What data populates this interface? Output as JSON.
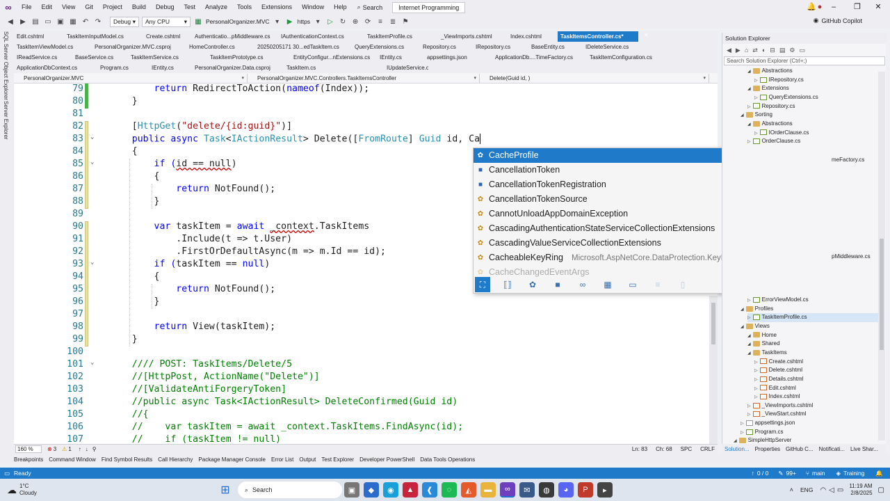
{
  "menu": [
    "File",
    "Edit",
    "View",
    "Git",
    "Project",
    "Build",
    "Debug",
    "Test",
    "Analyze",
    "Tools",
    "Extensions",
    "Window",
    "Help"
  ],
  "search_label": "Search",
  "project_tab": "Internet Programming",
  "toolbar": {
    "config": "Debug",
    "platform": "Any CPU",
    "startup": "PersonalOrganizer.MVC",
    "run_profile": "https",
    "copilot": "GitHub Copilot"
  },
  "left_strip": [
    "SQL Server Object Explorer",
    "Server Explorer"
  ],
  "doc_tabs": [
    [
      "Edit.cshtml",
      "TaskItemInputModel.cs",
      "Create.cshtml",
      "Authenticatio...pMiddleware.cs",
      "IAuthenticationContext.cs",
      "TaskItemProfile.cs",
      "_ViewImports.cshtml",
      "Index.cshtml",
      "TaskItemsController.cs*"
    ],
    [
      "TaskItemViewModel.cs",
      "PersonalOrganizer.MVC.csproj",
      "HomeController.cs",
      "20250205171 30...edTaskItem.cs",
      "QueryExtensions.cs",
      "Repository.cs",
      "IRepository.cs",
      "BaseEntity.cs",
      "IDeleteService.cs"
    ],
    [
      "IReadService.cs",
      "BaseService.cs",
      "TaskItemService.cs",
      "TaskItemPrototype.cs",
      "EntityConfigur...nExtensions.cs",
      "IEntity.cs",
      "appsettings.json",
      "ApplicationDb....TimeFactory.cs",
      "TaskItemConfiguration.cs"
    ],
    [
      "ApplicationDbContext.cs",
      "Program.cs",
      "IEntity.cs",
      "PersonalOrganizer.Data.csproj",
      "TaskItem.cs",
      "IUpdateService.cs"
    ]
  ],
  "nav": {
    "project": "PersonalOrganizer.MVC",
    "class": "PersonalOrganizer.MVC.Controllers.TaskItemsController",
    "member": "Delete(Guid id, )"
  },
  "line_numbers": [
    "79",
    "80",
    "81",
    "82",
    "83",
    "84",
    "85",
    "86",
    "87",
    "88",
    "89",
    "90",
    "91",
    "92",
    "93",
    "94",
    "95",
    "96",
    "97",
    "98",
    "99",
    "100",
    "101",
    "102",
    "103",
    "104",
    "105",
    "106",
    "107"
  ],
  "code": {
    "l79a": "        return ",
    "l79b": "RedirectToAction(",
    "l79c": "nameof",
    "l79d": "(Index));",
    "l80": "    }",
    "l82a": "    [",
    "l82b": "HttpGet",
    "l82c": "(",
    "l82d": "\"delete/{id:guid}\"",
    "l82e": ")]",
    "l83a": "    public async ",
    "l83b": "Task",
    "l83c": "<",
    "l83d": "IActionResult",
    "l83e": "> Delete([",
    "l83f": "FromRoute",
    "l83g": "] ",
    "l83h": "Guid",
    "l83i": " id, Ca",
    "l84": "    {",
    "l85a": "        if (",
    "l85b": "id == null",
    "l85c": ")",
    "l86": "        {",
    "l87a": "            return ",
    "l87b": "NotFound();",
    "l88": "        }",
    "l90a": "        var ",
    "l90b": "taskItem = ",
    "l90c": "await ",
    "l90d": "_context",
    "l90e": ".TaskItems",
    "l91": "            .Include(t => t.User)",
    "l92": "            .FirstOrDefaultAsync(m => m.Id == id);",
    "l93a": "        if (",
    "l93b": "taskItem == ",
    "l93c": "null",
    "l93d": ")",
    "l94": "        {",
    "l95a": "            return ",
    "l95b": "NotFound();",
    "l96": "        }",
    "l98a": "        return ",
    "l98b": "View(taskItem);",
    "l99": "    }",
    "l101": "    //// POST: TaskItems/Delete/5",
    "l102": "    //[HttpPost, ActionName(\"Delete\")]",
    "l103": "    //[ValidateAntiForgeryToken]",
    "l104": "    //public async Task<IActionResult> DeleteConfirmed(Guid id)",
    "l105": "    //{",
    "l106": "    //    var taskItem = await _context.TaskItems.FindAsync(id);",
    "l107": "    //    if (taskItem != null)"
  },
  "intellisense": [
    {
      "label": "CacheProfile",
      "icon": "class-icon",
      "ns": ""
    },
    {
      "label": "CancellationToken",
      "icon": "struct-icon",
      "ns": ""
    },
    {
      "label": "CancellationTokenRegistration",
      "icon": "struct-icon",
      "ns": ""
    },
    {
      "label": "CancellationTokenSource",
      "icon": "class-icon",
      "ns": ""
    },
    {
      "label": "CannotUnloadAppDomainException",
      "icon": "class-icon",
      "ns": ""
    },
    {
      "label": "CascadingAuthenticationStateServiceCollectionExtensions",
      "icon": "class-icon",
      "ns": ""
    },
    {
      "label": "CascadingValueServiceCollectionExtensions",
      "icon": "class-icon",
      "ns": ""
    },
    {
      "label": "CacheableKeyRing",
      "icon": "class-icon",
      "ns": "Microsoft.AspNetCore.DataProtection.KeyManagement.Internal"
    },
    {
      "label": "CacheChangedEventArgs",
      "icon": "class-icon",
      "ns": ""
    }
  ],
  "solution_explorer": {
    "title": "Solution Explorer",
    "search_placeholder": "Search Solution Explorer (Ctrl+;)",
    "nodes": [
      {
        "label": "Abstractions",
        "kind": "folder",
        "indent": 3
      },
      {
        "label": "IRepository.cs",
        "kind": "cs",
        "indent": 4
      },
      {
        "label": "Extensions",
        "kind": "folder",
        "indent": 3
      },
      {
        "label": "QueryExtensions.cs",
        "kind": "cs",
        "indent": 4
      },
      {
        "label": "Repository.cs",
        "kind": "cs",
        "indent": 3
      },
      {
        "label": "Sorting",
        "kind": "folder",
        "indent": 2
      },
      {
        "label": "Abstractions",
        "kind": "folder",
        "indent": 3
      },
      {
        "label": "IOrderClause.cs",
        "kind": "cs",
        "indent": 4
      },
      {
        "label": "OrderClause.cs",
        "kind": "cs",
        "indent": 3
      }
    ],
    "partial_right": [
      "meFactory.cs",
      "pMiddleware.cs"
    ],
    "nodes_lower": [
      {
        "label": "ErrorViewModel.cs",
        "kind": "cs",
        "indent": 3
      },
      {
        "label": "Profiles",
        "kind": "folder",
        "indent": 2
      },
      {
        "label": "TaskItemProfile.cs",
        "kind": "cs",
        "indent": 3,
        "selected": true
      },
      {
        "label": "Views",
        "kind": "folder",
        "indent": 2
      },
      {
        "label": "Home",
        "kind": "folder",
        "indent": 3
      },
      {
        "label": "Shared",
        "kind": "folder",
        "indent": 3
      },
      {
        "label": "TaskItems",
        "kind": "folder",
        "indent": 3
      },
      {
        "label": "Create.cshtml",
        "kind": "html",
        "indent": 4
      },
      {
        "label": "Delete.cshtml",
        "kind": "html",
        "indent": 4
      },
      {
        "label": "Details.cshtml",
        "kind": "html",
        "indent": 4
      },
      {
        "label": "Edit.cshtml",
        "kind": "html",
        "indent": 4
      },
      {
        "label": "Index.cshtml",
        "kind": "html",
        "indent": 4
      },
      {
        "label": "_ViewImports.cshtml",
        "kind": "html",
        "indent": 3
      },
      {
        "label": "_ViewStart.cshtml",
        "kind": "html",
        "indent": 3
      },
      {
        "label": "appsettings.json",
        "kind": "json",
        "indent": 2
      },
      {
        "label": "Program.cs",
        "kind": "cs",
        "indent": 2
      },
      {
        "label": "SimpleHttpServer",
        "kind": "folder",
        "indent": 1
      }
    ],
    "bottom_tabs": [
      "Solution...",
      "Properties",
      "GitHub C...",
      "Notificati...",
      "Live Shar..."
    ]
  },
  "editor_status": {
    "zoom": "160 %",
    "errors": "3",
    "warnings": "1",
    "line": "Ln: 83",
    "col": "Ch: 68",
    "spc": "SPC",
    "crlf": "CRLF"
  },
  "tool_tabs": [
    "Breakpoints",
    "Command Window",
    "Find Symbol Results",
    "Call Hierarchy",
    "Package Manager Console",
    "Error List",
    "Output",
    "Test Explorer",
    "Developer PowerShell",
    "Data Tools Operations"
  ],
  "status": {
    "ready": "Ready",
    "lines": "0 / 0",
    "count": "99+",
    "branch": "main",
    "project": "Training"
  },
  "taskbar": {
    "weather_temp": "1°C",
    "weather_desc": "Cloudy",
    "search": "Search",
    "lang": "ENG",
    "time": "11:19 AM",
    "date": "2/8/2025"
  },
  "colors": {
    "accent": "#1f7bc9",
    "keyword": "#0000ff",
    "type": "#2b91af",
    "string": "#a31515",
    "comment": "#008000"
  }
}
